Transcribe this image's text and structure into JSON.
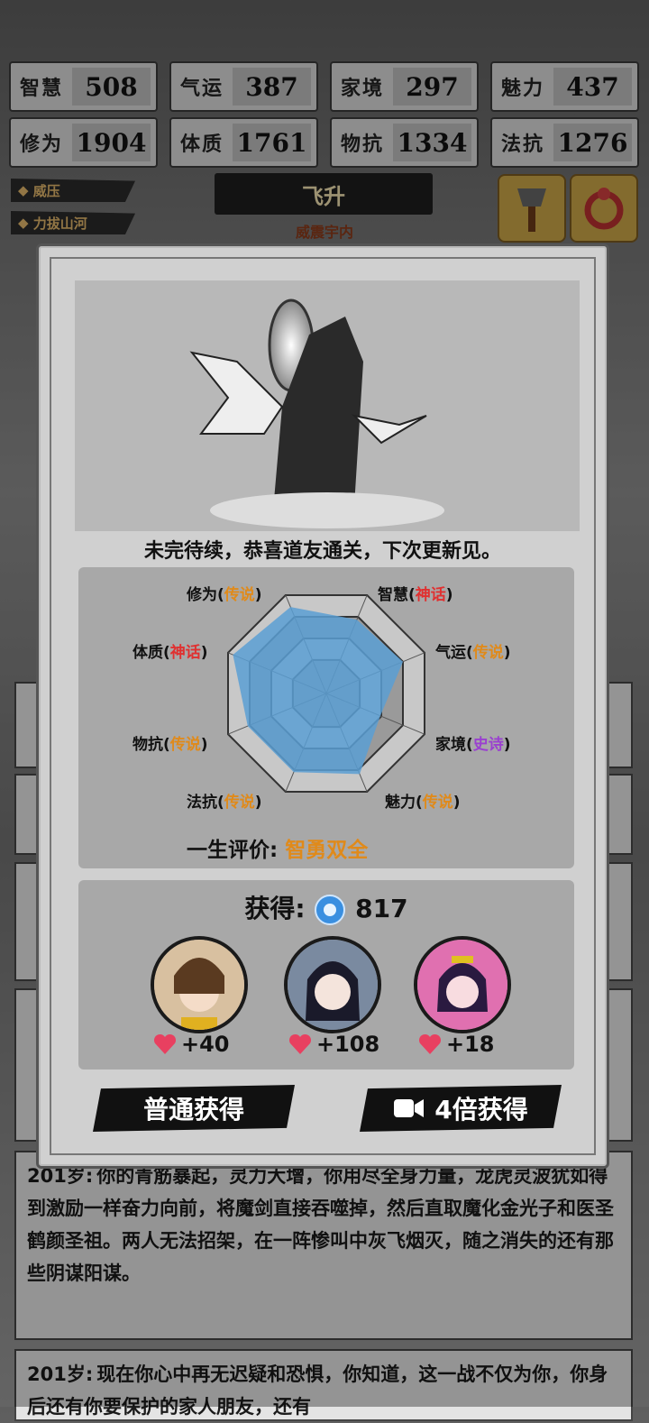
{
  "stats": [
    {
      "label": "智慧",
      "value": "508"
    },
    {
      "label": "气运",
      "value": "387"
    },
    {
      "label": "家境",
      "value": "297"
    },
    {
      "label": "魅力",
      "value": "437"
    },
    {
      "label": "修为",
      "value": "1904"
    },
    {
      "label": "体质",
      "value": "1761"
    },
    {
      "label": "物抗",
      "value": "1334"
    },
    {
      "label": "法抗",
      "value": "1276"
    }
  ],
  "skills": [
    "威压",
    "力拔山河"
  ],
  "banner": {
    "title": "飞升",
    "subtitle": "威震宇内"
  },
  "modal": {
    "caption": "未完待续，恭喜道友通关，下次更新见。",
    "radar": {
      "labels": [
        {
          "name": "修为",
          "grade": "传说",
          "color": "#e08a1a"
        },
        {
          "name": "智慧",
          "grade": "神话",
          "color": "#e03030"
        },
        {
          "name": "气运",
          "grade": "传说",
          "color": "#e08a1a"
        },
        {
          "name": "家境",
          "grade": "史诗",
          "color": "#9a40d0"
        },
        {
          "name": "魅力",
          "grade": "传说",
          "color": "#e08a1a"
        },
        {
          "name": "法抗",
          "grade": "传说",
          "color": "#e08a1a"
        },
        {
          "name": "物抗",
          "grade": "传说",
          "color": "#e08a1a"
        },
        {
          "name": "体质",
          "grade": "神话",
          "color": "#e03030"
        }
      ],
      "values": [
        0.88,
        0.75,
        0.78,
        0.55,
        0.82,
        0.8,
        0.8,
        0.95
      ]
    },
    "evaluation": {
      "label": "一生评价:",
      "value": "智勇双全"
    },
    "gain": {
      "label": "获得:",
      "value": "817",
      "icon": "spirit-orb-icon"
    },
    "companions": [
      {
        "affection": "+40",
        "icon": "heart-icon"
      },
      {
        "affection": "+108",
        "icon": "heart-icon"
      },
      {
        "affection": "+18",
        "icon": "heart-icon"
      }
    ],
    "buttons": {
      "normal": "普通获得",
      "quad": "4倍获得",
      "quad_icon": "video-icon"
    }
  },
  "log": [
    {
      "age": "201岁:",
      "text": "你的青筋暴起，灵力大增，你用尽全身力量，龙虎灵波犹如得到激励一样奋力向前，将魔剑直接吞噬掉，然后直取魔化金光子和医圣鹤颜圣祖。两人无法招架，在一阵惨叫中灰飞烟灭，随之消失的还有那些阴谋阳谋。"
    },
    {
      "age": "201岁:",
      "text": "现在你心中再无迟疑和恐惧，你知道，这一战不仅为你，你身后还有你要保护的家人朋友，还有"
    }
  ],
  "colors": {
    "accent": "#e08a1a",
    "myth": "#e03030",
    "epic": "#9a40d0",
    "radar_fill": "#5a9fd4"
  }
}
